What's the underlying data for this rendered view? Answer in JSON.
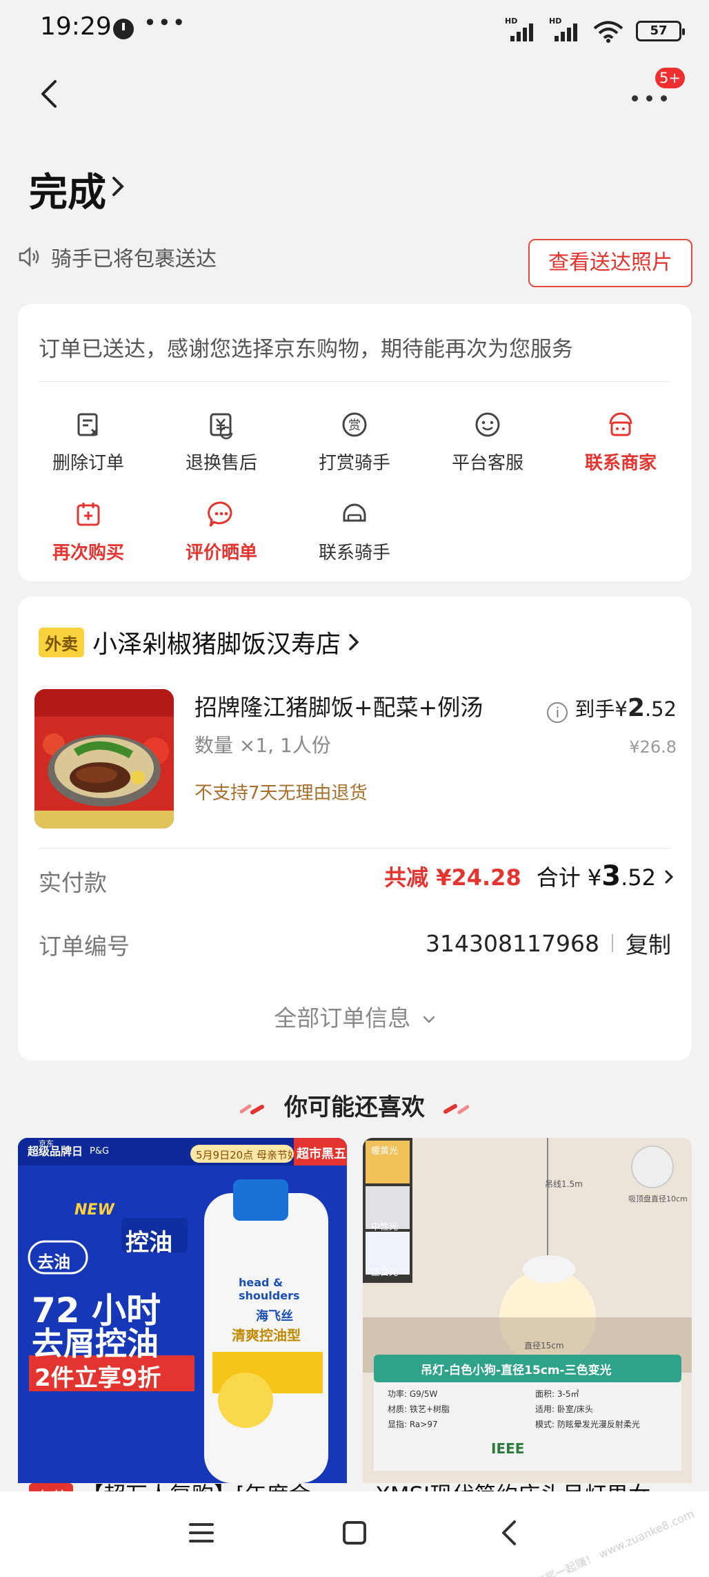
{
  "status_bar": {
    "time": "19:29",
    "dots": "•••",
    "sig1": "HD",
    "sig2": "HD",
    "battery": "57"
  },
  "header": {
    "badge": "5+",
    "status_title": "完成"
  },
  "rider_notice": {
    "text": "骑手已将包裹送达",
    "photo_button": "查看送达照片"
  },
  "order_card": {
    "thanks_text": "订单已送达，感谢您选择京东购物，期待能再次为您服务",
    "actions": [
      {
        "label": "删除订单",
        "icon": "delete-order-icon",
        "highlight": false
      },
      {
        "label": "退换售后",
        "icon": "refund-icon",
        "highlight": false
      },
      {
        "label": "打赏骑手",
        "icon": "reward-icon",
        "highlight": false
      },
      {
        "label": "平台客服",
        "icon": "service-icon",
        "highlight": false
      },
      {
        "label": "联系商家",
        "icon": "merchant-icon",
        "highlight": true
      },
      {
        "label": "再次购买",
        "icon": "rebuy-icon",
        "highlight": true
      },
      {
        "label": "评价晒单",
        "icon": "review-icon",
        "highlight": true
      },
      {
        "label": "联系骑手",
        "icon": "helmet-icon",
        "highlight": false
      }
    ]
  },
  "shop": {
    "tag": "外卖",
    "name": "小泽剁椒猪脚饭汉寿店",
    "item": {
      "name": "招牌隆江猪脚饭+配菜+例汤",
      "qty": "数量 ×1, 1人份",
      "note": "不支持7天无理由退货",
      "final_prefix": "到手¥",
      "final_int": "2",
      "final_dec": ".52",
      "info_icon": "i",
      "original_price": "¥26.8"
    },
    "paid_label": "实付款",
    "discount": "共减 ¥24.28",
    "total_prefix": "合计 ¥",
    "total_int": "3",
    "total_dec": ".52",
    "order_no_label": "订单编号",
    "order_no": "314308117968",
    "copy": "复制",
    "all_info": "全部订单信息"
  },
  "recommend": {
    "title": "你可能还喜欢",
    "products": [
      {
        "tag": "自营",
        "title": "【超万人复购】[年度金",
        "img_texts": {
          "brand": "超级品牌日",
          "jd": "京东",
          "pg": "P&G",
          "date": "5月9日20点 母亲节好礼",
          "corner": "超市黑五",
          "tag1": "去油",
          "new": "NEW",
          "tag2": "控油",
          "big1": "72 小时",
          "big2": "去屑控油",
          "promo": "2件立享9折",
          "bottle": "head & shoulders",
          "bottle_cn": "海飞丝",
          "bottle_type": "清爽控油型"
        }
      },
      {
        "tag": "",
        "title": "XMSJ现代简约床头吊灯男女",
        "img_texts": {
          "warm": "暖黄光",
          "neutral": "中性光",
          "white": "正白光",
          "cable": "吊线1.5m",
          "base": "吸顶盘直径10cm",
          "dia": "直径15cm",
          "banner": "吊灯-白色小狗-直径15cm-三色变光",
          "spec1": "功率: G9/5W",
          "spec2": "面积: 3-5㎡",
          "spec3": "材质: 铁艺+树脂",
          "spec4": "适用: 卧室/床头",
          "spec5": "显指: Ra>97",
          "spec6": "模式: 防眩晕发光漫反射柔光",
          "logo": "IEEE"
        }
      }
    ]
  },
  "watermark": "赚客吧，有奖一起赚！ www.zuanke8.com",
  "colors": {
    "accent": "#e3342f",
    "takeout_tag": "#f8d23d",
    "note": "#a56f2b"
  }
}
